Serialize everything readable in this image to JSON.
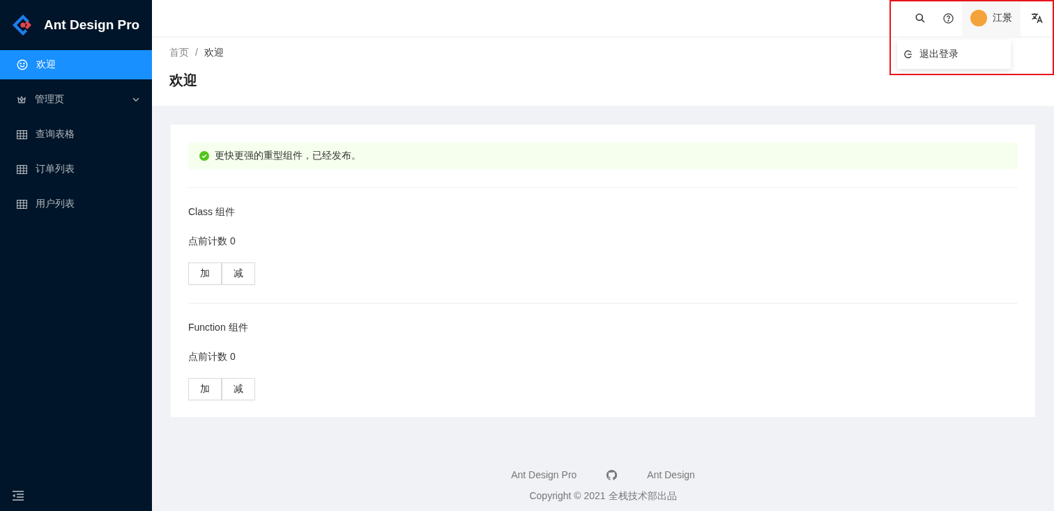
{
  "logo": {
    "title": "Ant Design Pro"
  },
  "sidebar": {
    "items": [
      {
        "label": "欢迎",
        "kind": "welcome",
        "selected": true
      },
      {
        "label": "管理页",
        "kind": "submenu",
        "selected": false,
        "expanded": false
      },
      {
        "label": "查询表格",
        "kind": "table",
        "selected": false
      },
      {
        "label": "订单列表",
        "kind": "table",
        "selected": false
      },
      {
        "label": "用户列表",
        "kind": "table",
        "selected": false
      }
    ]
  },
  "header": {
    "user": {
      "name": "江景"
    },
    "dropdown": {
      "items": [
        {
          "label": "退出登录",
          "kind": "logout"
        }
      ]
    }
  },
  "breadcrumb": {
    "items": [
      "首页",
      "欢迎"
    ],
    "separator": "/"
  },
  "page_title": "欢迎",
  "alert": {
    "kind": "success",
    "message": "更快更强的重型组件，已经发布。"
  },
  "sections": [
    {
      "title": "Class 组件",
      "counter": "点前计数 0",
      "buttons": [
        "加",
        "减"
      ]
    },
    {
      "title": "Function 组件",
      "counter": "点前计数 0",
      "buttons": [
        "加",
        "减"
      ]
    }
  ],
  "footer": {
    "links": [
      "Ant Design Pro",
      "Ant Design"
    ],
    "copyright": "Copyright © 2021 全栈技术部出品"
  }
}
